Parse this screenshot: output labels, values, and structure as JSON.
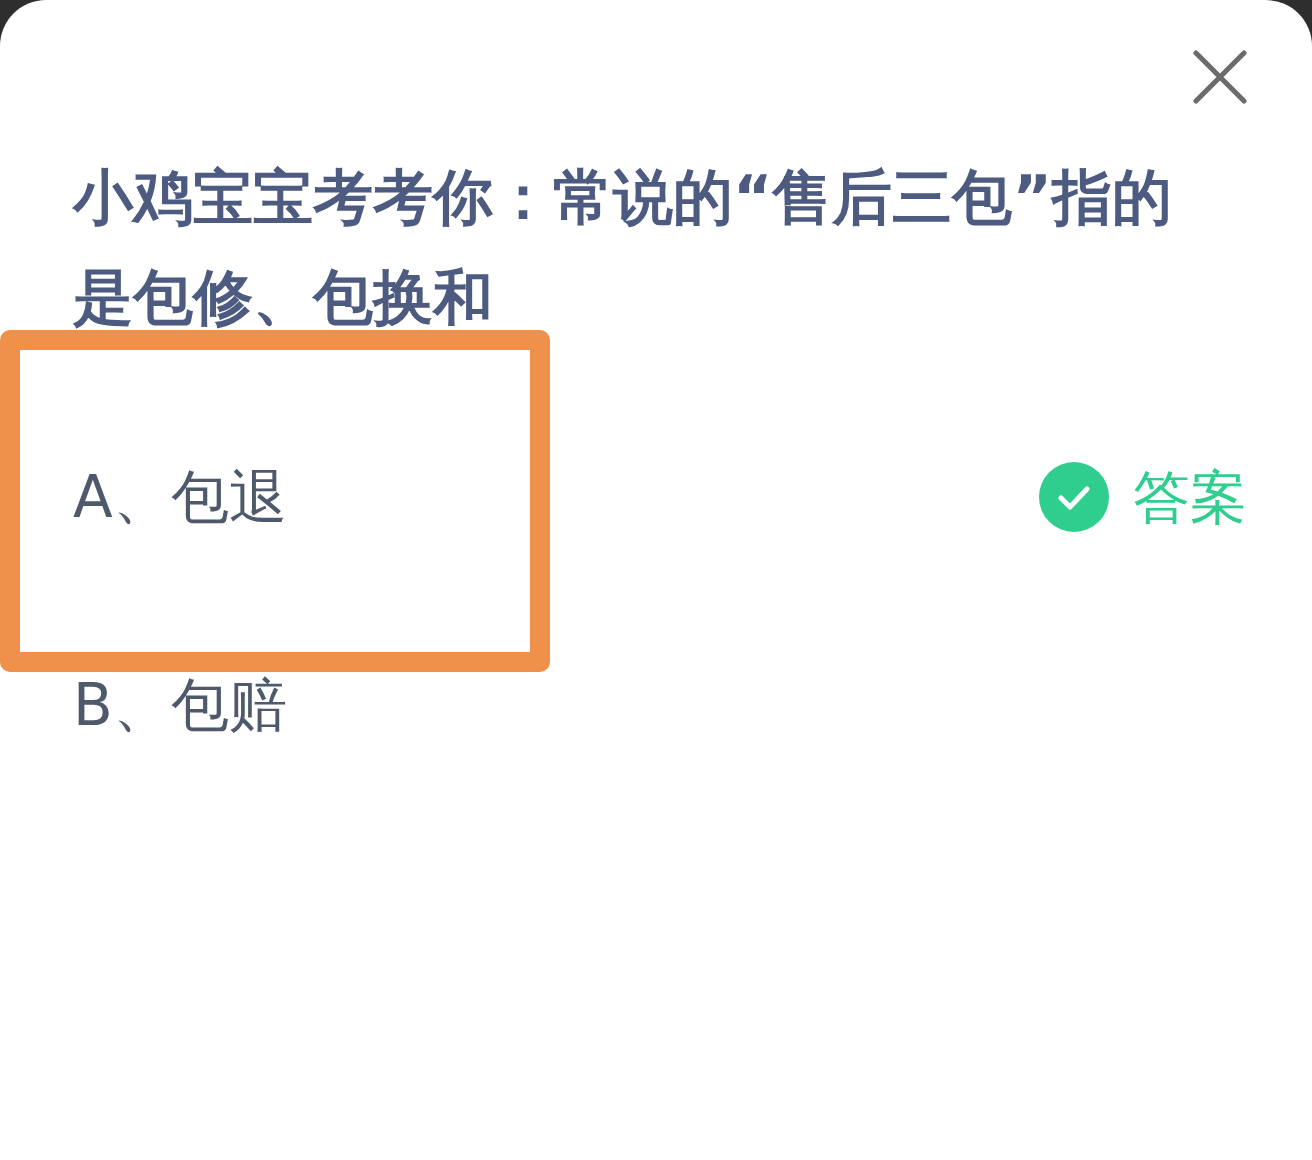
{
  "dialog": {
    "question": "小鸡宝宝考考你：常说的“售后三包”指的是包修、包换和",
    "options": [
      {
        "label": "A、包退",
        "correct": true,
        "answer_label": "答案",
        "highlighted": true
      },
      {
        "label": "B、包赔",
        "correct": false,
        "highlighted": false
      }
    ]
  }
}
